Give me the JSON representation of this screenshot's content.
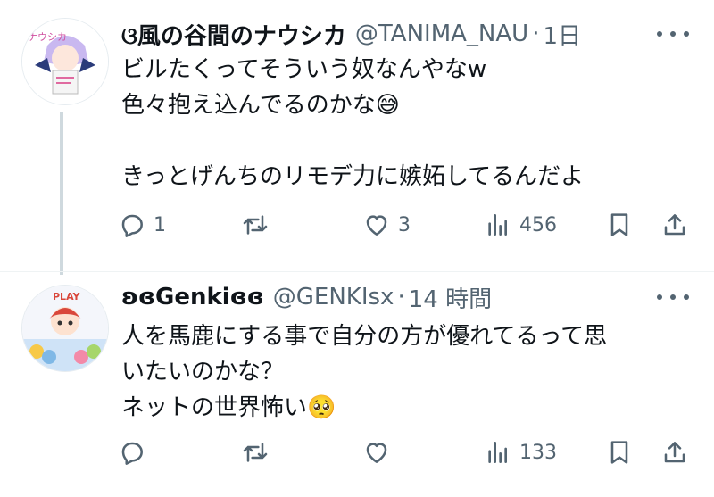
{
  "tweets": [
    {
      "display_name": "ଓ風の谷間のナウシカ",
      "handle": "@TANIMA_NAU",
      "dot": "·",
      "time": "1日",
      "text": "ビルたくってそういう奴なんやなw\n色々抱え込んでるのかな😅\n\nきっとげんちのリモデ力に嫉妬してるんだよ",
      "avatar_caption": "ナウシカ",
      "actions": {
        "replies": "1",
        "retweets": "",
        "likes": "3",
        "views": "456"
      }
    },
    {
      "display_name": "ʚɞGenkiɞɞ",
      "handle": "@GENKIsx",
      "dot": "·",
      "time": "14 時間",
      "text": "人を馬鹿にする事で自分の方が優れてるって思\nいたいのかな？\nネットの世界怖い🥺",
      "avatar_caption": "PLAY",
      "actions": {
        "replies": "",
        "retweets": "",
        "likes": "",
        "views": "133"
      }
    }
  ],
  "colors": {
    "text": "#0f1419",
    "muted": "#536471",
    "line": "#cfd9de"
  },
  "icons": [
    "reply-icon",
    "retweet-icon",
    "like-icon",
    "views-icon",
    "bookmark-icon",
    "share-icon",
    "more-icon"
  ]
}
